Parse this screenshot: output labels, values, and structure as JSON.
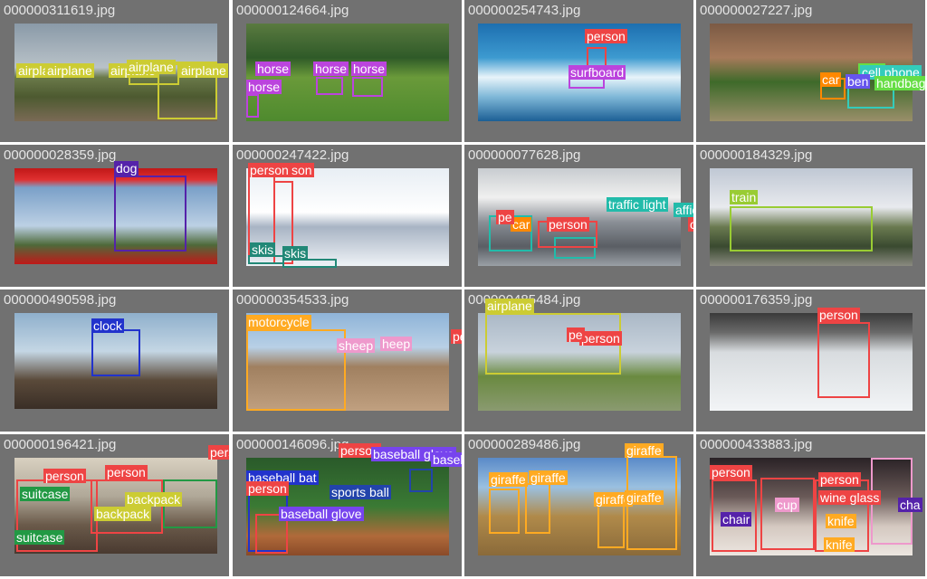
{
  "grid": {
    "tiles": [
      {
        "filename": "000000311619.jpg",
        "scene": "runway",
        "labels": [
          {
            "text": "airplane",
            "color": "#cccc33",
            "tc": "#ffffff"
          },
          {
            "text": "airplane",
            "color": "#cccc33",
            "tc": "#ffffff"
          },
          {
            "text": "airplane",
            "color": "#cccc33",
            "tc": "#ffffff"
          },
          {
            "text": "airplane",
            "color": "#cccc33",
            "tc": "#ffffff"
          },
          {
            "text": "airplane",
            "color": "#cccc33",
            "tc": "#ffffff"
          }
        ]
      },
      {
        "filename": "000000124664.jpg",
        "scene": "pasture",
        "labels": [
          {
            "text": "horse",
            "color": "#bb44dd",
            "tc": "#ffffff"
          },
          {
            "text": "horse",
            "color": "#bb44dd",
            "tc": "#ffffff"
          },
          {
            "text": "horse",
            "color": "#bb44dd",
            "tc": "#ffffff"
          },
          {
            "text": "horse",
            "color": "#bb44dd",
            "tc": "#ffffff"
          }
        ]
      },
      {
        "filename": "000000254743.jpg",
        "scene": "surf",
        "labels": [
          {
            "text": "person",
            "color": "#ee4444",
            "tc": "#ffffff"
          },
          {
            "text": "surfboard",
            "color": "#bb44dd",
            "tc": "#ffffff"
          }
        ]
      },
      {
        "filename": "000000027227.jpg",
        "scene": "park",
        "labels": [
          {
            "text": "car",
            "color": "#ff8800",
            "tc": "#ffffff"
          },
          {
            "text": "cell phone",
            "color": "#33ccbb",
            "tc": "#ffffff"
          },
          {
            "text": "handbag",
            "color": "#66dd44",
            "tc": "#ffffff"
          },
          {
            "text": "ben",
            "color": "#6655ee",
            "tc": "#ffffff"
          }
        ]
      },
      {
        "filename": "000000028359.jpg",
        "scene": "mirror",
        "labels": [
          {
            "text": "dog",
            "color": "#5522aa",
            "tc": "#ffffff"
          }
        ]
      },
      {
        "filename": "000000247422.jpg",
        "scene": "snow",
        "labels": [
          {
            "text": "person",
            "color": "#ee4444",
            "tc": "#ffffff"
          },
          {
            "text": "son",
            "color": "#ee4444",
            "tc": "#ffffff"
          },
          {
            "text": "skis",
            "color": "#228877",
            "tc": "#ffffff"
          },
          {
            "text": "skis",
            "color": "#228877",
            "tc": "#ffffff"
          }
        ]
      },
      {
        "filename": "000000077628.jpg",
        "scene": "street",
        "labels": [
          {
            "text": "traffic light",
            "color": "#22bbaa",
            "tc": "#ffffff"
          },
          {
            "text": "affic light",
            "color": "#22bbaa",
            "tc": "#ffffff"
          },
          {
            "text": "person",
            "color": "#ee4444",
            "tc": "#ffffff"
          },
          {
            "text": "car",
            "color": "#ff8800",
            "tc": "#ffffff"
          },
          {
            "text": "pe",
            "color": "#ee4444",
            "tc": "#ffffff"
          },
          {
            "text": "on",
            "color": "#ee4444",
            "tc": "#ffffff"
          }
        ]
      },
      {
        "filename": "000000184329.jpg",
        "scene": "train",
        "labels": [
          {
            "text": "train",
            "color": "#99cc33",
            "tc": "#ffffff"
          }
        ]
      },
      {
        "filename": "000000490598.jpg",
        "scene": "clock",
        "labels": [
          {
            "text": "clock",
            "color": "#2233cc",
            "tc": "#ffffff"
          }
        ]
      },
      {
        "filename": "000000354533.jpg",
        "scene": "moto",
        "labels": [
          {
            "text": "motorcycle",
            "color": "#ffaa22",
            "tc": "#ffffff"
          },
          {
            "text": "sheep",
            "color": "#ee99cc",
            "tc": "#ffffff"
          },
          {
            "text": "heep",
            "color": "#ee99cc",
            "tc": "#ffffff"
          },
          {
            "text": "person",
            "color": "#ee4444",
            "tc": "#ffffff"
          }
        ]
      },
      {
        "filename": "000000485484.jpg",
        "scene": "jet",
        "labels": [
          {
            "text": "airplane",
            "color": "#cccc33",
            "tc": "#ffffff"
          },
          {
            "text": "person",
            "color": "#ee4444",
            "tc": "#ffffff"
          },
          {
            "text": "pe",
            "color": "#ee4444",
            "tc": "#ffffff"
          }
        ]
      },
      {
        "filename": "000000176359.jpg",
        "scene": "skier",
        "labels": [
          {
            "text": "person",
            "color": "#ee4444",
            "tc": "#ffffff"
          }
        ]
      },
      {
        "filename": "000000196421.jpg",
        "scene": "room",
        "labels": [
          {
            "text": "person",
            "color": "#ee4444",
            "tc": "#ffffff"
          },
          {
            "text": "person",
            "color": "#ee4444",
            "tc": "#ffffff"
          },
          {
            "text": "suitcase",
            "color": "#229944",
            "tc": "#ffffff"
          },
          {
            "text": "backpack",
            "color": "#cccc33",
            "tc": "#ffffff"
          },
          {
            "text": "backpack",
            "color": "#cccc33",
            "tc": "#ffffff"
          },
          {
            "text": "suitcase",
            "color": "#229944",
            "tc": "#ffffff"
          },
          {
            "text": "person",
            "color": "#ee4444",
            "tc": "#ffffff"
          }
        ]
      },
      {
        "filename": "000000146096.jpg",
        "scene": "baseball",
        "labels": [
          {
            "text": "baseball bat",
            "color": "#2233cc",
            "tc": "#ffffff"
          },
          {
            "text": "person",
            "color": "#ee4444",
            "tc": "#ffffff"
          },
          {
            "text": "sports ball",
            "color": "#2244aa",
            "tc": "#ffffff"
          },
          {
            "text": "baseball glove",
            "color": "#7744ee",
            "tc": "#ffffff"
          },
          {
            "text": "person",
            "color": "#ee4444",
            "tc": "#ffffff"
          },
          {
            "text": "baseball glove",
            "color": "#7744ee",
            "tc": "#ffffff"
          },
          {
            "text": "baseball glove",
            "color": "#7744ee",
            "tc": "#ffffff"
          }
        ]
      },
      {
        "filename": "000000289486.jpg",
        "scene": "savanna",
        "labels": [
          {
            "text": "giraffe",
            "color": "#ffaa22",
            "tc": "#ffffff"
          },
          {
            "text": "giraffe",
            "color": "#ffaa22",
            "tc": "#ffffff"
          },
          {
            "text": "giraffe",
            "color": "#ffaa22",
            "tc": "#ffffff"
          },
          {
            "text": "giraffe",
            "color": "#ffaa22",
            "tc": "#ffffff"
          },
          {
            "text": "giraffe",
            "color": "#ffaa22",
            "tc": "#ffffff"
          }
        ]
      },
      {
        "filename": "000000433883.jpg",
        "scene": "dinner",
        "labels": [
          {
            "text": "person",
            "color": "#ee4444",
            "tc": "#ffffff"
          },
          {
            "text": "person",
            "color": "#ee4444",
            "tc": "#ffffff"
          },
          {
            "text": "wine glass",
            "color": "#ee4444",
            "tc": "#ffffff"
          },
          {
            "text": "cup",
            "color": "#ee99cc",
            "tc": "#ffffff"
          },
          {
            "text": "knife",
            "color": "#ffaa22",
            "tc": "#ffffff"
          },
          {
            "text": "knife",
            "color": "#ffaa22",
            "tc": "#ffffff"
          },
          {
            "text": "chair",
            "color": "#5522aa",
            "tc": "#ffffff"
          },
          {
            "text": "cha",
            "color": "#5522aa",
            "tc": "#ffffff"
          }
        ]
      }
    ]
  }
}
